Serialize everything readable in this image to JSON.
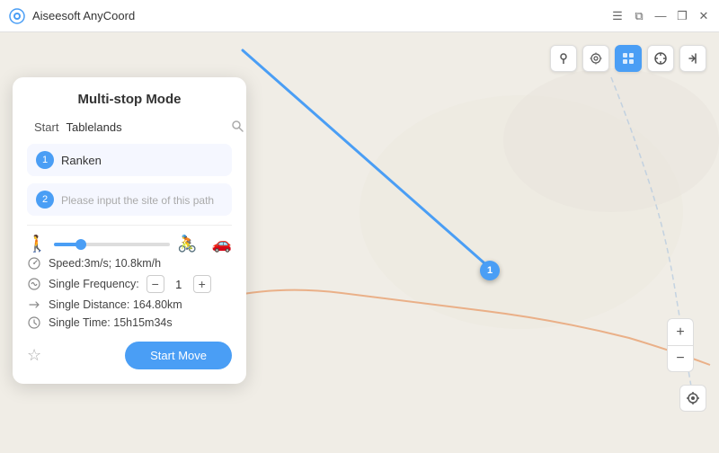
{
  "app": {
    "title": "Aiseesoft AnyCoord",
    "logo_color": "#4a9ef5"
  },
  "titlebar": {
    "title": "Aiseesoft AnyCoord",
    "controls": {
      "minimize": "—",
      "maximize": "❐",
      "close": "✕",
      "restore": "⧉",
      "menu": "☰"
    }
  },
  "panel": {
    "title": "Multi-stop Mode",
    "start_label": "Start",
    "start_placeholder": "Tablelands",
    "stops": [
      {
        "num": "1",
        "value": "Ranken",
        "placeholder": ""
      },
      {
        "num": "2",
        "value": "",
        "placeholder": "Please input the site of this path"
      }
    ],
    "speed_label": "Speed:",
    "speed_value": "3m/s; 10.8km/h",
    "frequency_label": "Single Frequency:",
    "frequency_value": "1",
    "distance_label": "Single Distance:",
    "distance_value": "164.80km",
    "time_label": "Single Time:",
    "time_value": "15h15m34s",
    "start_btn": "Start Move",
    "star_icon": "☆"
  },
  "toolbar": {
    "buttons": [
      {
        "id": "pin",
        "icon": "📍",
        "active": false
      },
      {
        "id": "route",
        "icon": "⚙",
        "active": false
      },
      {
        "id": "multi",
        "icon": "⊞",
        "active": true
      },
      {
        "id": "joystick",
        "icon": "⊕",
        "active": false
      },
      {
        "id": "exit",
        "icon": "⏏",
        "active": false
      }
    ]
  },
  "zoom": {
    "locate": "◎",
    "plus": "+",
    "minus": "−"
  },
  "map": {
    "marker_label": "1"
  }
}
